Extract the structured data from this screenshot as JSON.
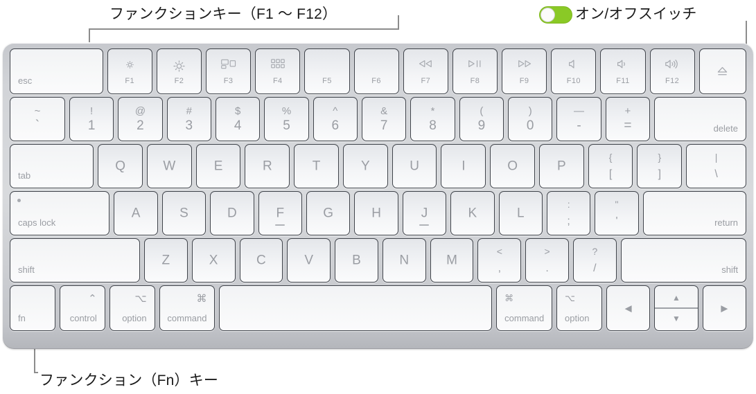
{
  "annotations": {
    "function_keys_label": "ファンクションキー（F1 〜 F12）",
    "on_off_switch_label": "オン/オフスイッチ",
    "fn_key_label": "ファンクション（Fn）キー",
    "switch_state": "on",
    "switch_color": "#8ac926",
    "leader_line_color": "#8c8c8c"
  },
  "keyboard": {
    "body_color": "#d3d5d9",
    "key_face_color": "#f4f5f7",
    "key_border_color": "#3f434a",
    "legend_color": "#9a9da3",
    "rows": {
      "function_row": [
        {
          "name": "esc",
          "label": "esc"
        },
        {
          "name": "f1",
          "fn": "F1",
          "icon": "brightness-down-icon"
        },
        {
          "name": "f2",
          "fn": "F2",
          "icon": "brightness-up-icon"
        },
        {
          "name": "f3",
          "fn": "F3",
          "icon": "mission-control-icon"
        },
        {
          "name": "f4",
          "fn": "F4",
          "icon": "launchpad-icon"
        },
        {
          "name": "f5",
          "fn": "F5",
          "icon": ""
        },
        {
          "name": "f6",
          "fn": "F6",
          "icon": ""
        },
        {
          "name": "f7",
          "fn": "F7",
          "icon": "rewind-icon"
        },
        {
          "name": "f8",
          "fn": "F8",
          "icon": "play-pause-icon"
        },
        {
          "name": "f9",
          "fn": "F9",
          "icon": "fast-forward-icon"
        },
        {
          "name": "f10",
          "fn": "F10",
          "icon": "mute-icon"
        },
        {
          "name": "f11",
          "fn": "F11",
          "icon": "volume-down-icon"
        },
        {
          "name": "f12",
          "fn": "F12",
          "icon": "volume-up-icon"
        },
        {
          "name": "eject",
          "fn": "",
          "icon": "eject-icon"
        }
      ],
      "number_row": [
        {
          "name": "grave",
          "top": "~",
          "bottom": "`"
        },
        {
          "name": "digit-1",
          "top": "!",
          "bottom": "1"
        },
        {
          "name": "digit-2",
          "top": "@",
          "bottom": "2"
        },
        {
          "name": "digit-3",
          "top": "#",
          "bottom": "3"
        },
        {
          "name": "digit-4",
          "top": "$",
          "bottom": "4"
        },
        {
          "name": "digit-5",
          "top": "%",
          "bottom": "5"
        },
        {
          "name": "digit-6",
          "top": "^",
          "bottom": "6"
        },
        {
          "name": "digit-7",
          "top": "&",
          "bottom": "7"
        },
        {
          "name": "digit-8",
          "top": "*",
          "bottom": "8"
        },
        {
          "name": "digit-9",
          "top": "(",
          "bottom": "9"
        },
        {
          "name": "digit-0",
          "top": ")",
          "bottom": "0"
        },
        {
          "name": "minus",
          "top": "—",
          "bottom": "-"
        },
        {
          "name": "equal",
          "top": "+",
          "bottom": "="
        },
        {
          "name": "delete",
          "label": "delete"
        }
      ],
      "top_letter_row": [
        {
          "name": "tab",
          "label": "tab"
        },
        {
          "name": "key-q",
          "letter": "Q"
        },
        {
          "name": "key-w",
          "letter": "W"
        },
        {
          "name": "key-e",
          "letter": "E"
        },
        {
          "name": "key-r",
          "letter": "R"
        },
        {
          "name": "key-t",
          "letter": "T"
        },
        {
          "name": "key-y",
          "letter": "Y"
        },
        {
          "name": "key-u",
          "letter": "U"
        },
        {
          "name": "key-i",
          "letter": "I"
        },
        {
          "name": "key-o",
          "letter": "O"
        },
        {
          "name": "key-p",
          "letter": "P"
        },
        {
          "name": "bracket-left",
          "top": "{",
          "bottom": "["
        },
        {
          "name": "bracket-right",
          "top": "}",
          "bottom": "]"
        },
        {
          "name": "backslash",
          "top": "|",
          "bottom": "\\"
        }
      ],
      "home_row": [
        {
          "name": "caps-lock",
          "label": "caps lock",
          "indicator": true
        },
        {
          "name": "key-a",
          "letter": "A"
        },
        {
          "name": "key-s",
          "letter": "S"
        },
        {
          "name": "key-d",
          "letter": "D"
        },
        {
          "name": "key-f",
          "letter": "F",
          "homing": true
        },
        {
          "name": "key-g",
          "letter": "G"
        },
        {
          "name": "key-h",
          "letter": "H"
        },
        {
          "name": "key-j",
          "letter": "J",
          "homing": true
        },
        {
          "name": "key-k",
          "letter": "K"
        },
        {
          "name": "key-l",
          "letter": "L"
        },
        {
          "name": "semicolon",
          "top": ":",
          "bottom": ";"
        },
        {
          "name": "quote",
          "top": "\"",
          "bottom": "'"
        },
        {
          "name": "return",
          "label": "return"
        }
      ],
      "bottom_letter_row": [
        {
          "name": "shift-left",
          "label": "shift"
        },
        {
          "name": "key-z",
          "letter": "Z"
        },
        {
          "name": "key-x",
          "letter": "X"
        },
        {
          "name": "key-c",
          "letter": "C"
        },
        {
          "name": "key-v",
          "letter": "V"
        },
        {
          "name": "key-b",
          "letter": "B"
        },
        {
          "name": "key-n",
          "letter": "N"
        },
        {
          "name": "key-m",
          "letter": "M"
        },
        {
          "name": "comma",
          "top": "<",
          "bottom": ","
        },
        {
          "name": "period",
          "top": ">",
          "bottom": "."
        },
        {
          "name": "slash",
          "top": "?",
          "bottom": "/"
        },
        {
          "name": "shift-right",
          "label": "shift"
        }
      ],
      "modifier_row": [
        {
          "name": "fn",
          "label": "fn",
          "symbol": ""
        },
        {
          "name": "control-left",
          "label": "control",
          "symbol": "⌃"
        },
        {
          "name": "option-left",
          "label": "option",
          "symbol": "⌥"
        },
        {
          "name": "command-left",
          "label": "command",
          "symbol": "⌘"
        },
        {
          "name": "space",
          "label": "",
          "symbol": ""
        },
        {
          "name": "command-right",
          "label": "command",
          "symbol": "⌘"
        },
        {
          "name": "option-right",
          "label": "option",
          "symbol": "⌥"
        },
        {
          "name": "arrow-left",
          "label": "",
          "symbol": "◀"
        },
        {
          "name": "arrow-up-down",
          "up": "▲",
          "down": "▼"
        },
        {
          "name": "arrow-right",
          "label": "",
          "symbol": "▶"
        }
      ]
    }
  }
}
